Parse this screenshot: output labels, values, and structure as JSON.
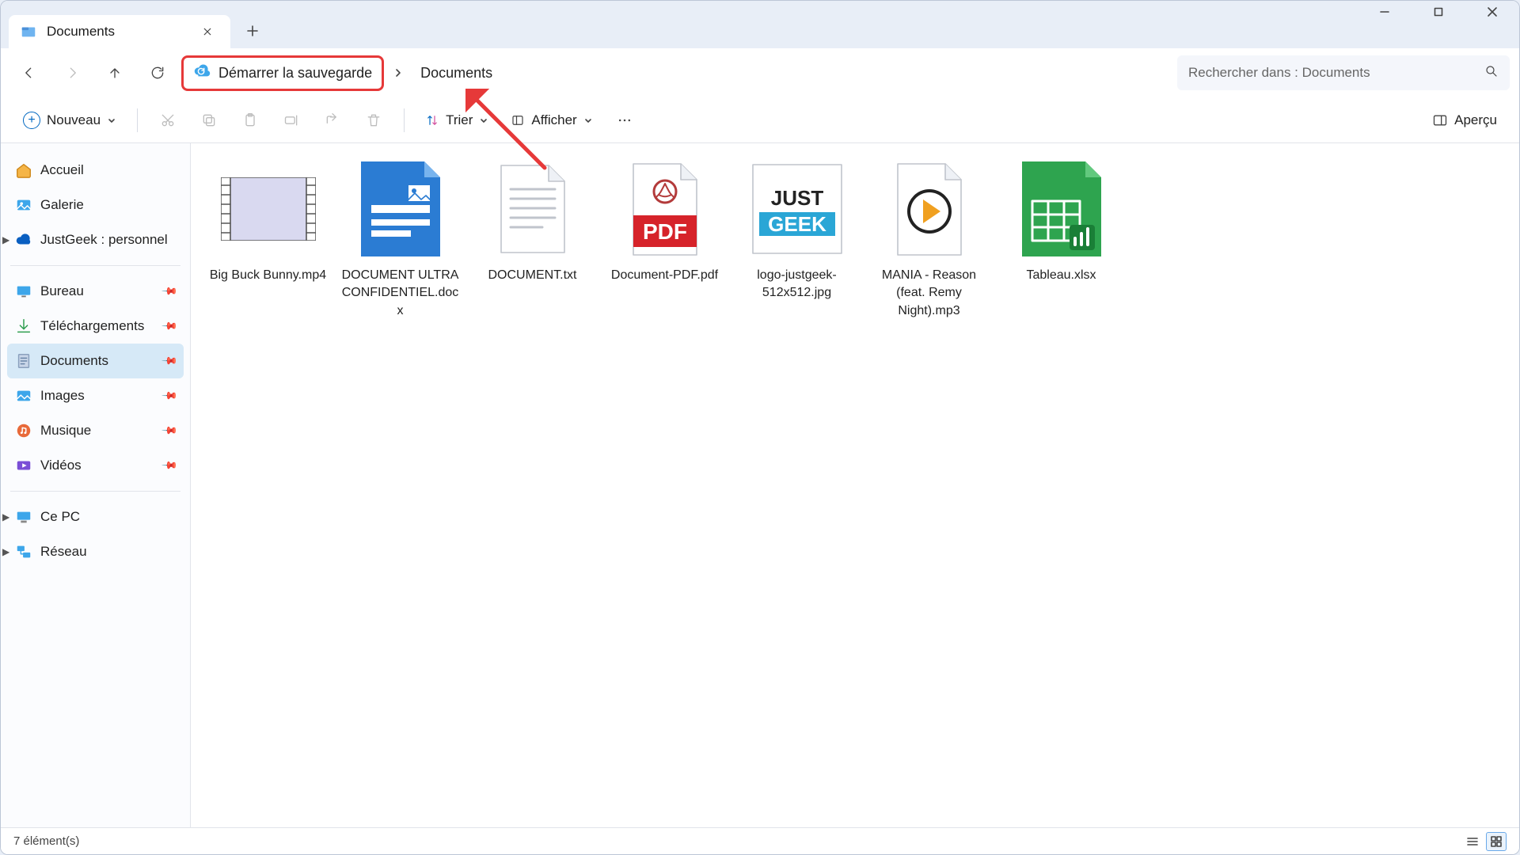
{
  "tab": {
    "title": "Documents"
  },
  "address": {
    "backup_label": "Démarrer la sauvegarde",
    "crumb": "Documents"
  },
  "search": {
    "placeholder": "Rechercher dans : Documents"
  },
  "toolbar": {
    "new_label": "Nouveau",
    "sort_label": "Trier",
    "view_label": "Afficher",
    "preview_label": "Aperçu"
  },
  "sidebar": {
    "home": "Accueil",
    "gallery": "Galerie",
    "onedrive": "JustGeek : personnel",
    "desktop": "Bureau",
    "downloads": "Téléchargements",
    "documents": "Documents",
    "images": "Images",
    "music": "Musique",
    "videos": "Vidéos",
    "thispc": "Ce PC",
    "network": "Réseau"
  },
  "files": [
    {
      "name": "Big Buck Bunny.mp4"
    },
    {
      "name": "DOCUMENT ULTRA CONFIDENTIEL.docx"
    },
    {
      "name": "DOCUMENT.txt"
    },
    {
      "name": "Document-PDF.pdf"
    },
    {
      "name": "logo-justgeek-512x512.jpg"
    },
    {
      "name": "MANIA - Reason (feat. Remy Night).mp3"
    },
    {
      "name": "Tableau.xlsx"
    }
  ],
  "status": {
    "count_text": "7 élément(s)"
  }
}
